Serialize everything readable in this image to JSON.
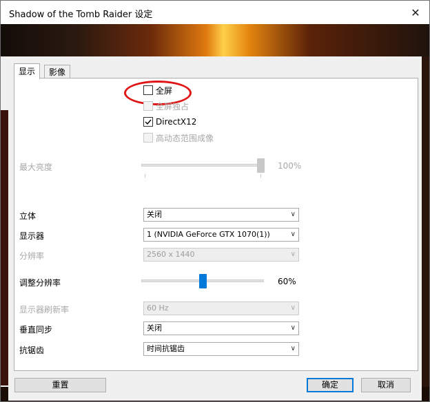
{
  "window": {
    "title": "Shadow of the Tomb Raider 设定",
    "close_glyph": "✕"
  },
  "tabs": [
    {
      "label": "显示",
      "active": true
    },
    {
      "label": "影像",
      "active": false
    }
  ],
  "display": {
    "fullscreen": {
      "label": "全屏",
      "checked": false,
      "enabled": true
    },
    "exclusive_fullscreen": {
      "label": "全屏独占",
      "checked": false,
      "enabled": false
    },
    "directx12": {
      "label": "DirectX12",
      "checked": true,
      "enabled": true
    },
    "hdr": {
      "label": "高动态范围成像",
      "checked": false,
      "enabled": false
    },
    "max_brightness": {
      "label": "最大亮度",
      "value": 100,
      "value_text": "100%",
      "enabled": false
    },
    "stereo": {
      "label": "立体",
      "value": "关闭"
    },
    "monitor": {
      "label": "显示器",
      "value": "1 (NVIDIA GeForce GTX 1070(1))"
    },
    "resolution": {
      "label": "分辨率",
      "value": "2560 x 1440",
      "enabled": false
    },
    "resolution_scale": {
      "label": "调整分辨率",
      "value": 60,
      "value_text": "60%"
    },
    "refresh_rate": {
      "label": "显示器刷新率",
      "value": "60 Hz",
      "enabled": false
    },
    "vsync": {
      "label": "垂直同步",
      "value": "关闭"
    },
    "antialiasing": {
      "label": "抗锯齿",
      "value": "时间抗锯齿"
    }
  },
  "buttons": {
    "reset": "重置",
    "ok": "确定",
    "cancel": "取消"
  },
  "colors": {
    "accent": "#0078d7",
    "highlight_ring": "#e01616"
  }
}
